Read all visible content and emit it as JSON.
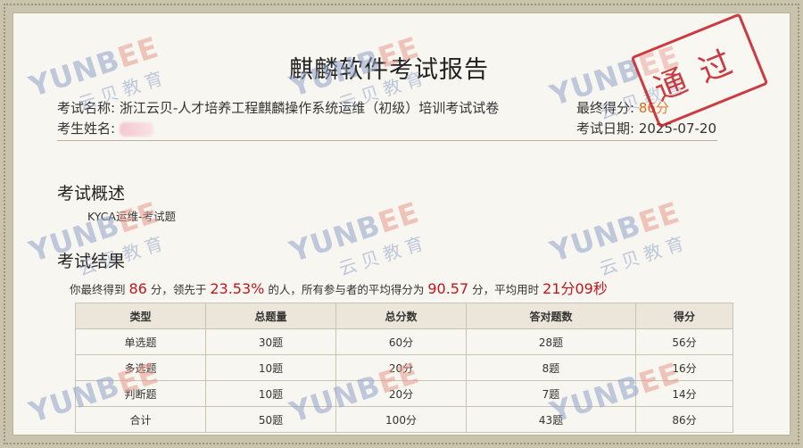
{
  "report": {
    "title": "麒麟软件考试报告",
    "exam_name_label": "考试名称:",
    "exam_name": "浙江云贝-人才培养工程麒麟操作系统运维（初级）培训考试试卷",
    "examinee_label": "考生姓名:",
    "final_score_label": "最终得分:",
    "final_score": "86分",
    "exam_date_label": "考试日期:",
    "exam_date": "2025-07-20",
    "stamp_text": "通过"
  },
  "overview": {
    "heading": "考试概述",
    "item": "KYCA运维-考试题"
  },
  "results": {
    "heading": "考试结果",
    "summary": {
      "p1": "你最终得到",
      "score": "86",
      "p2": "分，领先于",
      "percent": "23.53%",
      "p3": "的人，所有参与者的平均得分为",
      "avg": "90.57",
      "p4": "分，平均用时",
      "time": "21分09秒"
    },
    "table": {
      "headers": [
        "类型",
        "总题量",
        "总分数",
        "答对题数",
        "得分"
      ],
      "rows": [
        [
          "单选题",
          "30题",
          "60分",
          "28题",
          "56分"
        ],
        [
          "多选题",
          "10题",
          "20分",
          "8题",
          "16分"
        ],
        [
          "判断题",
          "10题",
          "20分",
          "7题",
          "14分"
        ],
        [
          "合计",
          "50题",
          "100分",
          "43题",
          "86分"
        ]
      ]
    }
  },
  "watermark": {
    "en_pre": "YUNB",
    "en_e": "EE",
    "cn": "云贝教育"
  }
}
